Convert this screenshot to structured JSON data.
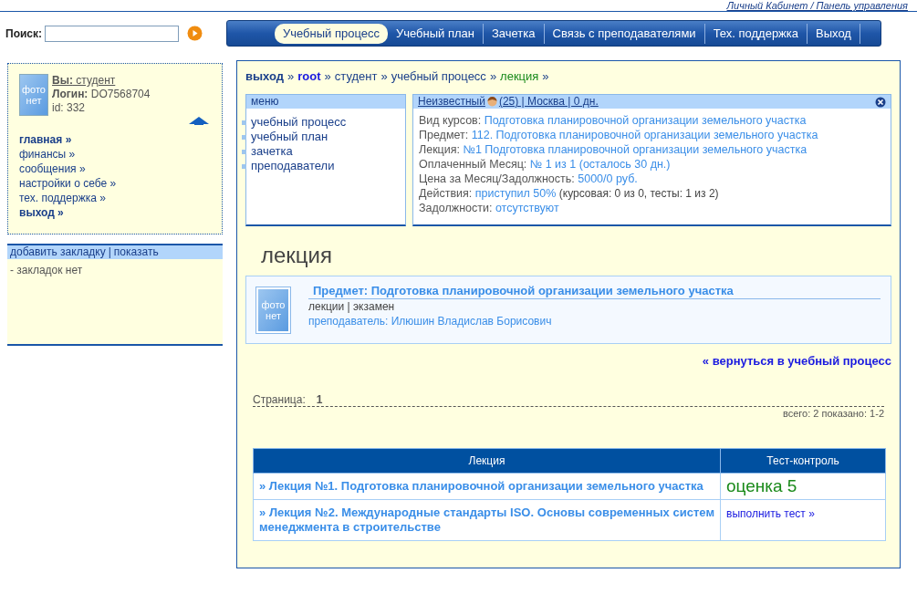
{
  "header": {
    "link": "Личный Кабинет / Панель управления"
  },
  "search": {
    "label": "Поиск:"
  },
  "nav": [
    {
      "label": "Учебный процесс",
      "selected": true
    },
    {
      "label": "Учебный план",
      "selected": false
    },
    {
      "label": "Зачетка",
      "selected": false
    },
    {
      "label": "Связь с преподавателями",
      "selected": false
    },
    {
      "label": "Тех. поддержка",
      "selected": false
    },
    {
      "label": "Выход",
      "selected": false
    }
  ],
  "profile": {
    "photo": "фото нет",
    "you_label": "Вы:",
    "you_value": "студент",
    "login_label": "Логин:",
    "login_value": "DO7568704",
    "id": "id: 332",
    "links": [
      {
        "label": "главная »",
        "bold": true
      },
      {
        "label": "финансы »",
        "bold": false
      },
      {
        "label": "сообщения »",
        "bold": false
      },
      {
        "label": "настройки о себе »",
        "bold": false
      },
      {
        "label": "тех. поддержка »",
        "bold": false
      },
      {
        "label": "выход »",
        "bold": true
      }
    ]
  },
  "bookmarks": {
    "add": "добавить закладку",
    "separator": "|",
    "show": "показать",
    "empty": "- закладок нет"
  },
  "breadcrumb_separator": "»",
  "breadcrumbs": [
    {
      "label": "выход",
      "kind": "bold"
    },
    {
      "label": "root",
      "kind": "root"
    },
    {
      "label": "студент",
      "kind": "plain"
    },
    {
      "label": "учебный процесс",
      "kind": "plain"
    },
    {
      "label": "лекция",
      "kind": "current"
    }
  ],
  "menu": {
    "title": "меню",
    "items": [
      "учебный процесс",
      "учебный план",
      "зачетка",
      "преподаватели"
    ]
  },
  "info": {
    "title": "Неизвестный",
    "details": "(25) | Москва | 0 дн.",
    "rows": [
      {
        "label": "Вид курсов:",
        "value": "Подготовка планировочной организации земельного участка"
      },
      {
        "label": "Предмет:",
        "value": "112. Подготовка планировочной организации земельного участка"
      },
      {
        "label": "Лекция:",
        "value": "№1 Подготовка планировочной организации земельного участка"
      },
      {
        "label": "Оплаченный Месяц:",
        "value": "№ 1 из 1 (осталось 30 дн.)"
      },
      {
        "label": "Цена за Месяц/Задолжность:",
        "value": "5000/0 руб."
      },
      {
        "label": "Действия:",
        "value": "приступил 50%",
        "note": "(курсовая: 0 из 0, тесты: 1 из 2)"
      },
      {
        "label": "Задолжности:",
        "value": "отсутствуют"
      }
    ]
  },
  "page_title": "лекция",
  "subject": {
    "photo": "фото нет",
    "title": "Предмет: Подготовка планировочной организации земельного участка",
    "types": "лекции | экзамен",
    "teacher": "преподаватель: Илюшин Владислав Борисович"
  },
  "back_link": "« вернуться в учебный процесс",
  "pager": {
    "label": "Страница:",
    "page": "1",
    "summary": "всего: 2 показано: 1-2"
  },
  "table": {
    "columns": [
      "Лекция",
      "Тест-контроль"
    ],
    "rows": [
      {
        "lecture": "» Лекция №1. Подготовка планировочной организации земельного участка",
        "test": {
          "kind": "grade",
          "text": "оценка 5"
        }
      },
      {
        "lecture": "» Лекция №2. Международные стандарты ISO. Основы современных систем менеджмента в строительстве",
        "test": {
          "kind": "link",
          "text": "выполнить тест »"
        }
      }
    ]
  }
}
